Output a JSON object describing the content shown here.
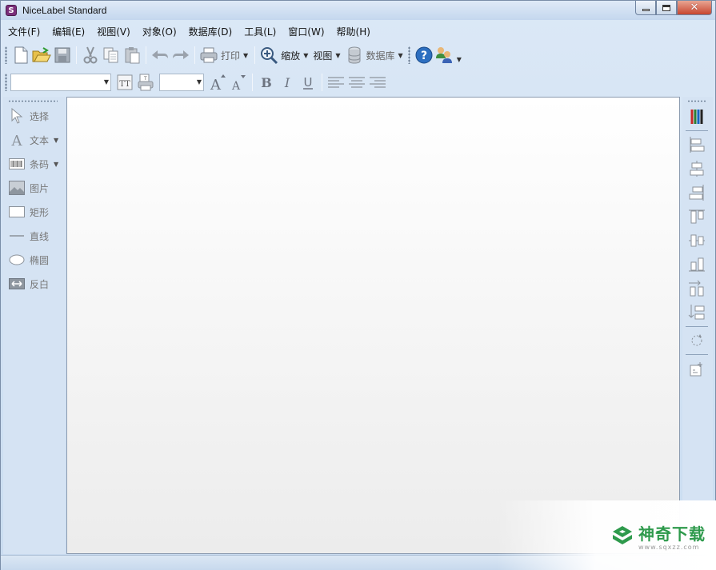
{
  "window": {
    "title": "NiceLabel Standard",
    "icon_letter": "S"
  },
  "menu": [
    {
      "label": "文件(F)"
    },
    {
      "label": "编辑(E)"
    },
    {
      "label": "视图(V)"
    },
    {
      "label": "对象(O)"
    },
    {
      "label": "数据库(D)"
    },
    {
      "label": "工具(L)"
    },
    {
      "label": "窗口(W)"
    },
    {
      "label": "帮助(H)"
    }
  ],
  "toolbar": {
    "print_label": "打印",
    "zoom_label": "缩放",
    "view_label": "视图",
    "database_label": "数据库"
  },
  "tools": [
    {
      "label": "选择",
      "icon": "pointer-icon"
    },
    {
      "label": "文本",
      "icon": "text-icon"
    },
    {
      "label": "条码",
      "icon": "barcode-icon"
    },
    {
      "label": "图片",
      "icon": "picture-icon"
    },
    {
      "label": "矩形",
      "icon": "rectangle-icon"
    },
    {
      "label": "直线",
      "icon": "line-icon"
    },
    {
      "label": "椭圆",
      "icon": "ellipse-icon"
    },
    {
      "label": "反白",
      "icon": "inverse-icon"
    }
  ],
  "watermark": {
    "name": "神奇下载",
    "url": "www.sqxzz.com"
  },
  "colors": {
    "accent_green": "#2e9a4c",
    "frame_blue": "#c9dcf0"
  }
}
